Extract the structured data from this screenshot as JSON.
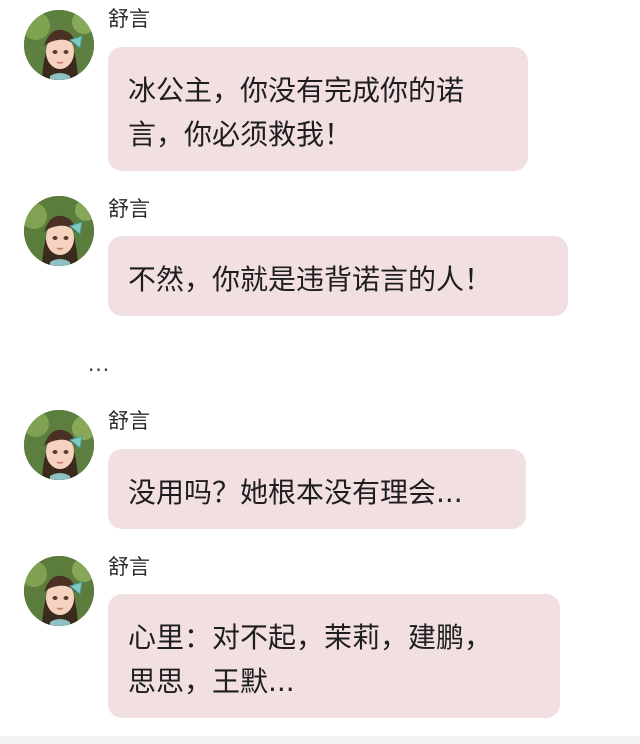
{
  "messages": [
    {
      "sender": "舒言",
      "lines": [
        "冰公主，你没有完成你的诺",
        "言，你必须救我！"
      ]
    },
    {
      "sender": "舒言",
      "lines": [
        "不然，你就是违背诺言的人！"
      ]
    },
    {
      "sender": "舒言",
      "lines": [
        "没用吗？她根本没有理会..."
      ]
    },
    {
      "sender": "舒言",
      "lines": [
        "心里：对不起，茉莉，建鹏，",
        "思思，王默..."
      ]
    }
  ],
  "separator": "...",
  "colors": {
    "bubble": "#f1dfe1",
    "background": "#ffffff",
    "text": "#1e1e1e"
  }
}
